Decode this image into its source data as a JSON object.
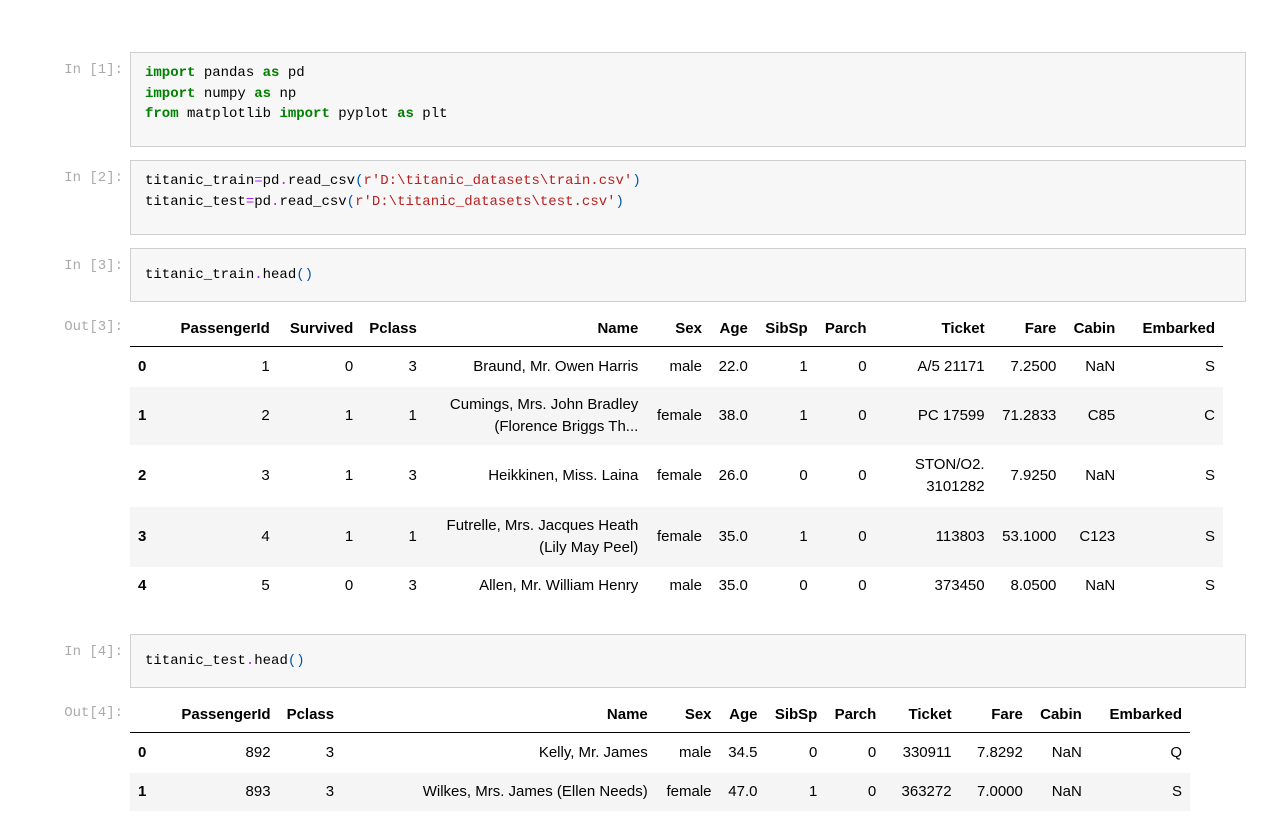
{
  "cells": [
    {
      "prompt": "In [1]:"
    },
    {
      "prompt": "In [2]:"
    },
    {
      "prompt": "In [3]:"
    },
    {
      "prompt": "In [4]:"
    }
  ],
  "code": {
    "c1": {
      "l1_kw1": "import",
      "l1_mod": " pandas ",
      "l1_kw2": "as",
      "l1_alias": " pd",
      "l2_kw1": "import",
      "l2_mod": " numpy ",
      "l2_kw2": "as",
      "l2_alias": " np",
      "l3_kw1": "from",
      "l3_mod": " matplotlib ",
      "l3_kw2": "import",
      "l3_sub": " pyplot ",
      "l3_kw3": "as",
      "l3_alias": " plt"
    },
    "c2": {
      "l1_var": "titanic_train",
      "l1_eq": "=",
      "l1_fn1": "pd",
      "l1_dot": ".",
      "l1_fn2": "read_csv",
      "l1_p1": "(",
      "l1_str": "r'D:\\titanic_datasets\\train.csv'",
      "l1_p2": ")",
      "l2_var": "titanic_test",
      "l2_eq": "=",
      "l2_fn1": "pd",
      "l2_dot": ".",
      "l2_fn2": "read_csv",
      "l2_p1": "(",
      "l2_str": "r'D:\\titanic_datasets\\test.csv'",
      "l2_p2": ")"
    },
    "c3": {
      "var": "titanic_train",
      "dot": ".",
      "fn": "head",
      "paren": "()"
    },
    "c4": {
      "var": "titanic_test",
      "dot": ".",
      "fn": "head",
      "paren": "()"
    }
  },
  "outputs": [
    {
      "prompt": "Out[3]:"
    },
    {
      "prompt": "Out[4]:"
    }
  ],
  "train_table": {
    "columns": [
      "",
      "PassengerId",
      "Survived",
      "Pclass",
      "Name",
      "Sex",
      "Age",
      "SibSp",
      "Parch",
      "Ticket",
      "Fare",
      "Cabin",
      "Embarked"
    ],
    "rows": [
      [
        "0",
        "1",
        "0",
        "3",
        "Braund, Mr. Owen Harris",
        "male",
        "22.0",
        "1",
        "0",
        "A/5 21171",
        "7.2500",
        "NaN",
        "S"
      ],
      [
        "1",
        "2",
        "1",
        "1",
        "Cumings, Mrs. John Bradley",
        "female",
        "38.0",
        "1",
        "0",
        "PC 17599",
        "71.2833",
        "C85",
        "C"
      ],
      [
        "2",
        "3",
        "1",
        "3",
        "Heikkinen, Miss. Laina",
        "female",
        "26.0",
        "0",
        "0",
        "STON/O2.",
        "7.9250",
        "NaN",
        "S"
      ],
      [
        "3",
        "4",
        "1",
        "1",
        "Futrelle, Mrs. Jacques Heath",
        "female",
        "35.0",
        "1",
        "0",
        "113803",
        "53.1000",
        "C123",
        "S"
      ],
      [
        "4",
        "5",
        "0",
        "3",
        "Allen, Mr. William Henry",
        "male",
        "35.0",
        "0",
        "0",
        "373450",
        "8.0500",
        "NaN",
        "S"
      ]
    ],
    "name_line2": [
      "",
      "(Florence Briggs Th...",
      "",
      "(Lily May Peel)",
      ""
    ],
    "ticket_line2": [
      "",
      "",
      "3101282",
      "",
      ""
    ]
  },
  "test_table": {
    "columns": [
      "",
      "PassengerId",
      "Pclass",
      "Name",
      "Sex",
      "Age",
      "SibSp",
      "Parch",
      "Ticket",
      "Fare",
      "Cabin",
      "Embarked"
    ],
    "rows": [
      [
        "0",
        "892",
        "3",
        "Kelly, Mr. James",
        "male",
        "34.5",
        "0",
        "0",
        "330911",
        "7.8292",
        "NaN",
        "Q"
      ],
      [
        "1",
        "893",
        "3",
        "Wilkes, Mrs. James (Ellen Needs)",
        "female",
        "47.0",
        "1",
        "0",
        "363272",
        "7.0000",
        "NaN",
        "S"
      ]
    ]
  }
}
